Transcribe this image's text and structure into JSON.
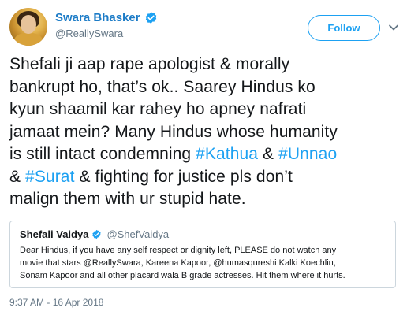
{
  "author": {
    "display_name": "Swara Bhasker",
    "handle": "@ReallySwara"
  },
  "follow_label": "Follow",
  "tweet": {
    "lines": [
      [
        {
          "text": "Shefali ji aap rape apologist & morally"
        }
      ],
      [
        {
          "text": "bankrupt ho, that’s ok.. Saarey Hindus ko"
        }
      ],
      [
        {
          "text": "kyun shaamil kar rahey ho apney nafrati"
        }
      ],
      [
        {
          "text": "jamaat mein? Many Hindus whose humanity"
        }
      ],
      [
        {
          "text": "is still intact condemning "
        },
        {
          "text": "#Kathua",
          "tag": true
        },
        {
          "text": " & "
        },
        {
          "text": "#Unnao",
          "tag": true
        }
      ],
      [
        {
          "text": "& "
        },
        {
          "text": "#Surat",
          "tag": true
        },
        {
          "text": " & fighting for justice pls don’t"
        }
      ],
      [
        {
          "text": "malign them with ur stupid hate."
        }
      ]
    ]
  },
  "quote": {
    "display_name": "Shefali Vaidya",
    "handle": "@ShefVaidya",
    "lines": [
      "Dear Hindus, if you have any self respect or dignity left, PLEASE do not watch any",
      "movie that stars @ReallySwara, Kareena Kapoor, @humasqureshi Kalki Koechlin,",
      "Sonam Kapoor and all other placard wala B grade actresses. Hit them where it hurts."
    ]
  },
  "timestamp": "9:37 AM - 16 Apr 2018",
  "colors": {
    "link": "#1da1f2",
    "name": "#1d7cc7",
    "muted": "#657786",
    "border": "#ccd6dd"
  },
  "icons": {
    "verified": "verified-badge-icon",
    "menu": "chevron-down-icon"
  }
}
